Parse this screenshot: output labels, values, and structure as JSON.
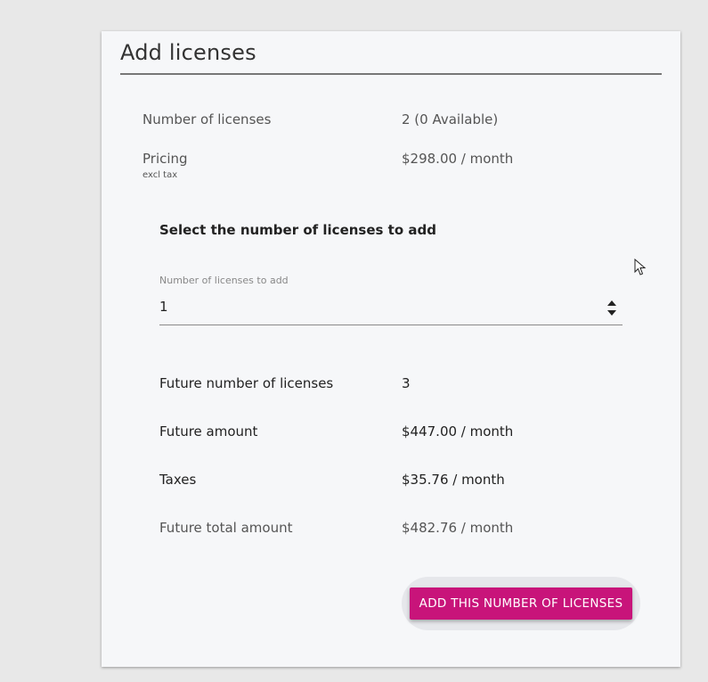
{
  "card": {
    "title": "Add licenses"
  },
  "current": {
    "licenses_label": "Number of licenses",
    "licenses_value": "2 (0 Available)",
    "pricing_label": "Pricing",
    "pricing_note": "excl tax",
    "pricing_value": "$298.00 / month"
  },
  "selector": {
    "heading": "Select the number of licenses to add",
    "field_label": "Number of licenses to add",
    "field_value": "1"
  },
  "future": {
    "licenses_label": "Future number of licenses",
    "licenses_value": "3",
    "amount_label": "Future amount",
    "amount_value": "$447.00 / month",
    "taxes_label": "Taxes",
    "taxes_value": "$35.76 / month",
    "total_label": "Future total amount",
    "total_value": "$482.76 / month"
  },
  "actions": {
    "add_label": "ADD THIS NUMBER OF LICENSES"
  },
  "colors": {
    "accent": "#c8147a",
    "card_bg": "#f6f7f9",
    "page_bg": "#e8e8e8"
  },
  "icons": {
    "spinner": "number-spinner-icon",
    "cursor": "mouse-pointer-icon"
  }
}
